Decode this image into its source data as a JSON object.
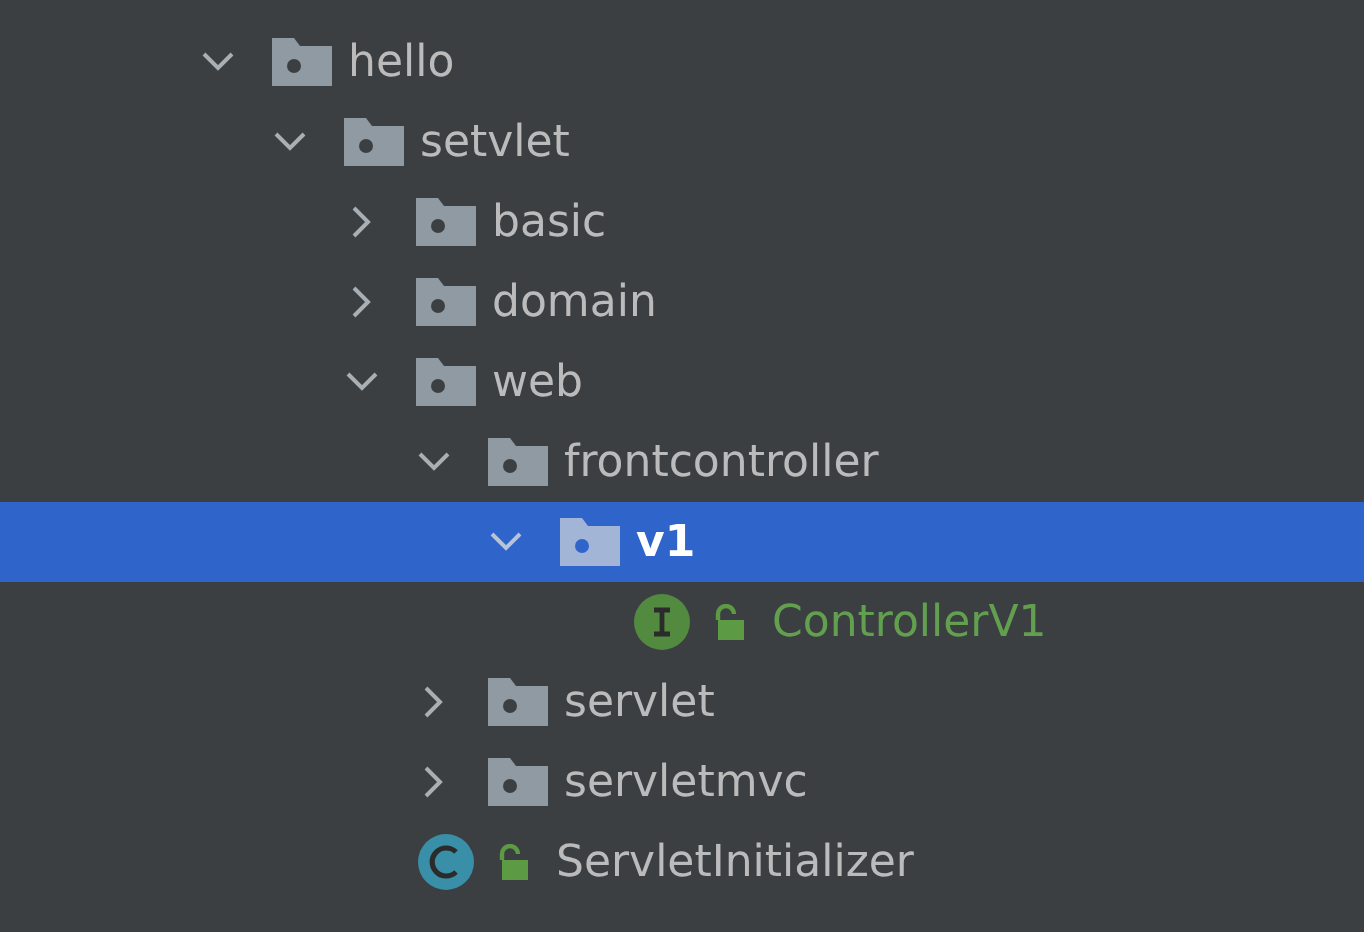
{
  "tree": [
    {
      "label": "hello",
      "kind": "package",
      "expanded": true,
      "selected": false,
      "color": "#bbbbbb",
      "children": [
        {
          "label": "setvlet",
          "kind": "package",
          "expanded": true,
          "selected": false,
          "color": "#bbbbbb",
          "children": [
            {
              "label": "basic",
              "kind": "package",
              "expanded": false,
              "selected": false,
              "color": "#bbbbbb"
            },
            {
              "label": "domain",
              "kind": "package",
              "expanded": false,
              "selected": false,
              "color": "#bbbbbb"
            },
            {
              "label": "web",
              "kind": "package",
              "expanded": true,
              "selected": false,
              "color": "#bbbbbb",
              "children": [
                {
                  "label": "frontcontroller",
                  "kind": "package",
                  "expanded": true,
                  "selected": false,
                  "color": "#bbbbbb",
                  "children": [
                    {
                      "label": "v1",
                      "kind": "package",
                      "expanded": true,
                      "selected": true,
                      "color": "#ffffff",
                      "children": [
                        {
                          "label": "ControllerV1",
                          "kind": "interface",
                          "selected": false,
                          "color": "#62a04f"
                        }
                      ]
                    }
                  ]
                },
                {
                  "label": "servlet",
                  "kind": "package",
                  "expanded": false,
                  "selected": false,
                  "color": "#bbbbbb"
                },
                {
                  "label": "servletmvc",
                  "kind": "package",
                  "expanded": false,
                  "selected": false,
                  "color": "#bbbbbb"
                }
              ]
            },
            {
              "label": "ServletInitializer",
              "kind": "class",
              "selected": false,
              "color": "#bbbbbb"
            }
          ]
        }
      ]
    }
  ]
}
